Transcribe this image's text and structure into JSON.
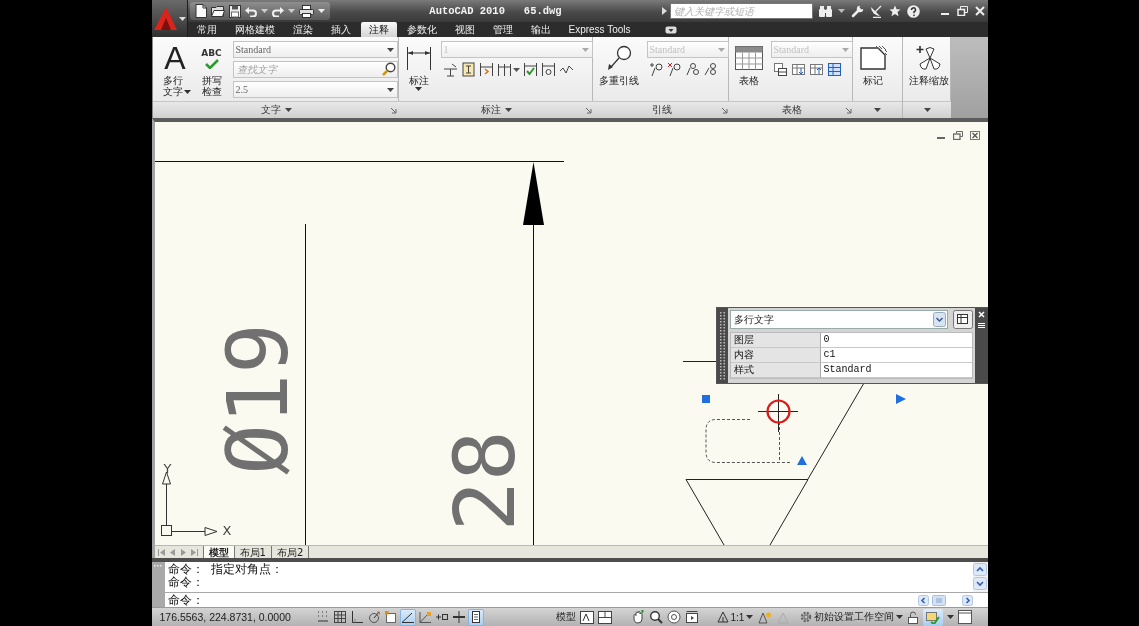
{
  "title_bar": {
    "title": "AutoCAD 2010   65.dwg",
    "search": {
      "placeholder": "键入关键字或短语"
    }
  },
  "tabs": [
    {
      "label": "常用",
      "selected": false
    },
    {
      "label": "网格建模",
      "selected": false
    },
    {
      "label": "渲染",
      "selected": false
    },
    {
      "label": "插入",
      "selected": false
    },
    {
      "label": "注释",
      "selected": true
    },
    {
      "label": "参数化",
      "selected": false
    },
    {
      "label": "视图",
      "selected": false
    },
    {
      "label": "管理",
      "selected": false
    },
    {
      "label": "输出",
      "selected": false
    },
    {
      "label": "Express Tools",
      "selected": false
    }
  ],
  "ribbon": {
    "panels": [
      {
        "kind": "text",
        "title": "文字",
        "expandable": true,
        "launcher": true,
        "buttons": [
          {
            "kind": "multiline_text",
            "glyph": "A",
            "label": "多行文字",
            "dropdown": true
          },
          {
            "kind": "spell_check",
            "glyph": "ABC",
            "label": "拼写检查",
            "dropdown": false
          }
        ],
        "fields": [
          {
            "kind": "dropdown",
            "value": "Standard",
            "disabled": false
          },
          {
            "kind": "search",
            "placeholder": "查找文字"
          },
          {
            "kind": "dropdown",
            "value": "2.5",
            "disabled": false
          }
        ]
      },
      {
        "kind": "dimension",
        "title": "标注",
        "expandable": true,
        "launcher": true,
        "buttons": [
          {
            "kind": "dimension",
            "label": "标注",
            "dropdown": true
          }
        ],
        "fields": [
          {
            "kind": "dropdown",
            "value": "1",
            "disabled": true
          }
        ]
      },
      {
        "kind": "leader",
        "title": "引线",
        "expandable": false,
        "launcher": true,
        "buttons": [
          {
            "kind": "multileader",
            "label": "多重引线",
            "dropdown": false
          }
        ],
        "fields": [
          {
            "kind": "dropdown",
            "value": "Standard",
            "disabled": true
          }
        ]
      },
      {
        "kind": "table",
        "title": "表格",
        "expandable": false,
        "launcher": true,
        "buttons": [
          {
            "kind": "table",
            "label": "表格",
            "dropdown": false
          }
        ],
        "fields": [
          {
            "kind": "dropdown",
            "value": "Standard",
            "disabled": true
          }
        ]
      },
      {
        "kind": "markup",
        "expandable": true,
        "launcher": false,
        "buttons": [
          {
            "kind": "markup",
            "label": "标记",
            "dropdown": false
          }
        ]
      },
      {
        "kind": "scale",
        "expandable": true,
        "launcher": false,
        "buttons": [
          {
            "kind": "annotation_scale",
            "label": "注释缩放",
            "dropdown": false
          }
        ]
      }
    ]
  },
  "drawing": {
    "dimension_texts": [
      "Ø19",
      "28"
    ],
    "axis_labels": {
      "x": "X",
      "y": "Y"
    }
  },
  "quick_properties": {
    "type": "多行文字",
    "rows": [
      {
        "label": "图层",
        "value": "0"
      },
      {
        "label": "内容",
        "value": "c1"
      },
      {
        "label": "样式",
        "value": "Standard"
      }
    ]
  },
  "layout_tabs": [
    {
      "label": "模型",
      "selected": true
    },
    {
      "label": "布局1",
      "selected": false
    },
    {
      "label": "布局2",
      "selected": false
    }
  ],
  "command_line": {
    "history": [
      "命令： 指定对角点：",
      "命令："
    ],
    "prompt": "命令："
  },
  "status_bar": {
    "coordinates": "176.5563, 224.8731, 0.0000",
    "toggles": [
      {
        "kind": "snap",
        "on": false
      },
      {
        "kind": "grid",
        "on": false
      },
      {
        "kind": "ortho",
        "on": false
      },
      {
        "kind": "polar",
        "on": false
      },
      {
        "kind": "osnap",
        "on": false
      },
      {
        "kind": "otrack",
        "on": true
      },
      {
        "kind": "ducs",
        "on": false
      },
      {
        "kind": "dyn",
        "on": false
      },
      {
        "kind": "lwt",
        "on": false
      },
      {
        "kind": "qp",
        "on": true
      }
    ],
    "space": "模型",
    "annotation_scale": "1:1",
    "workspace": "初始设置工作空间"
  }
}
